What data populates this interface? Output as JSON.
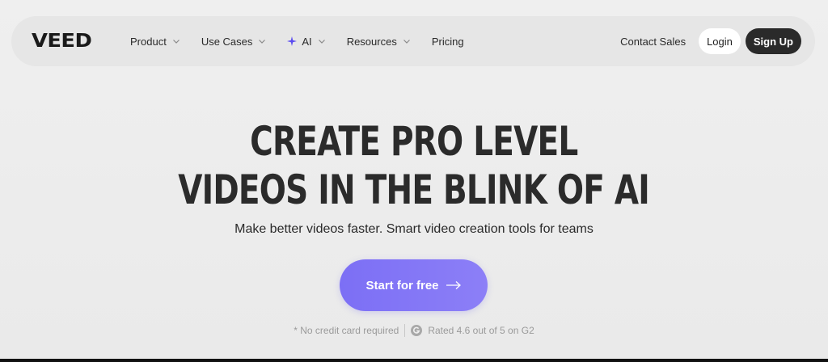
{
  "header": {
    "logo": "VEED",
    "nav": [
      {
        "label": "Product",
        "has_dropdown": true
      },
      {
        "label": "Use Cases",
        "has_dropdown": true
      },
      {
        "label": "AI",
        "has_dropdown": true,
        "icon": "sparkle-icon"
      },
      {
        "label": "Resources",
        "has_dropdown": true
      },
      {
        "label": "Pricing",
        "has_dropdown": false
      }
    ],
    "contact_sales": "Contact Sales",
    "login": "Login",
    "sign_up": "Sign Up"
  },
  "hero": {
    "headline_line1": "CREATE PRO LEVEL",
    "headline_line2": "VIDEOS IN THE BLINK OF AI",
    "subtitle": "Make better videos faster. Smart video creation tools for teams",
    "cta_label": "Start for free",
    "note_no_card": "* No credit card required",
    "note_rating": "Rated 4.6 out of 5 on G2"
  },
  "colors": {
    "background": "#ebebeb",
    "nav_pill": "#e6e6e6",
    "cta": "#7c6ff5",
    "dark_button": "#2a2a2a",
    "sparkle": "#5b4cf0"
  }
}
